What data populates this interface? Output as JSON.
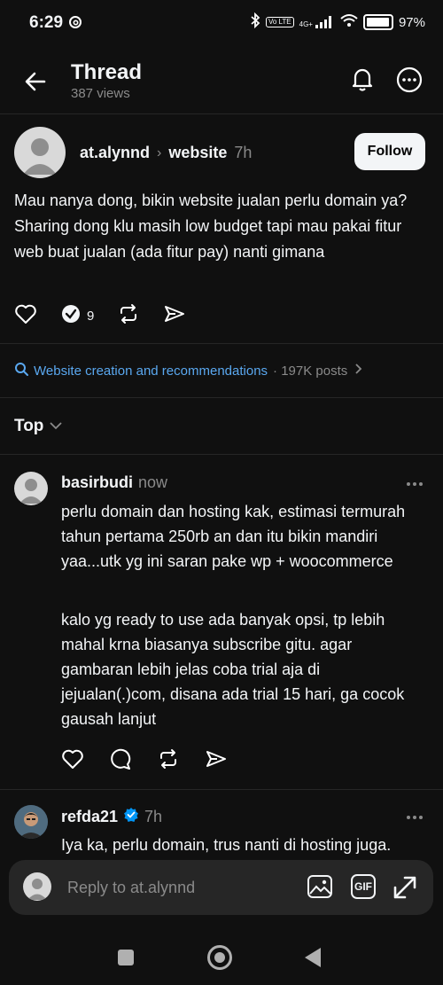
{
  "status_bar": {
    "time": "6:29",
    "network": "4G+",
    "volte": "Vo LTE",
    "battery": "97%"
  },
  "header": {
    "title": "Thread",
    "views": "387 views"
  },
  "post": {
    "username": "at.alynnd",
    "community": "website",
    "time": "7h",
    "follow_label": "Follow",
    "text": "Mau nanya dong, bikin website jualan perlu domain ya? Sharing dong klu masih low budget tapi mau pakai fitur web buat jualan (ada fitur pay) nanti gimana",
    "reply_count": "9"
  },
  "topic": {
    "label": "Website creation and recommendations",
    "posts": "· 197K posts"
  },
  "sort": {
    "label": "Top"
  },
  "replies": [
    {
      "username": "basirbudi",
      "time": "now",
      "paragraphs": [
        "perlu domain dan hosting kak, estimasi termurah tahun pertama 250rb an dan itu bikin mandiri yaa...utk yg ini saran pake wp + woocommerce",
        "kalo yg ready to use ada banyak opsi, tp lebih mahal krna biasanya subscribe gitu. agar gambaran lebih jelas coba trial aja di jejualan(.)com, disana ada trial 15 hari, ga cocok gausah lanjut"
      ]
    },
    {
      "username": "refda21",
      "time": "7h",
      "paragraphs": [
        "Iya ka, perlu domain, trus nanti di hosting juga."
      ]
    }
  ],
  "composer": {
    "placeholder": "Reply to at.alynnd",
    "gif_label": "GIF"
  },
  "colors": {
    "background": "#101010",
    "link": "#5aa8f0",
    "verified": "#0095f6"
  }
}
